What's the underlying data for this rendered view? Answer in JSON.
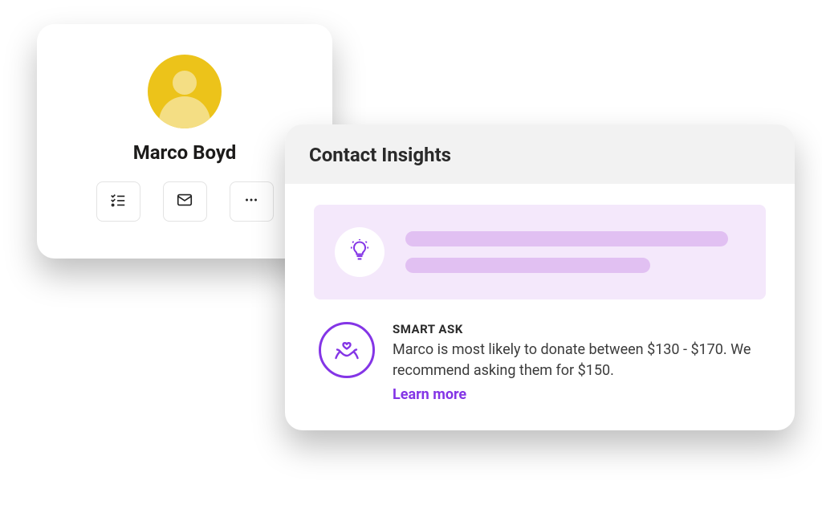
{
  "profile": {
    "name": "Marco Boyd"
  },
  "insights": {
    "title": "Contact Insights",
    "smart_ask": {
      "label": "SMART ASK",
      "body": "Marco is most likely to donate between $130 - $170. We recommend asking them for $150.",
      "learn_more_label": "Learn more"
    }
  }
}
